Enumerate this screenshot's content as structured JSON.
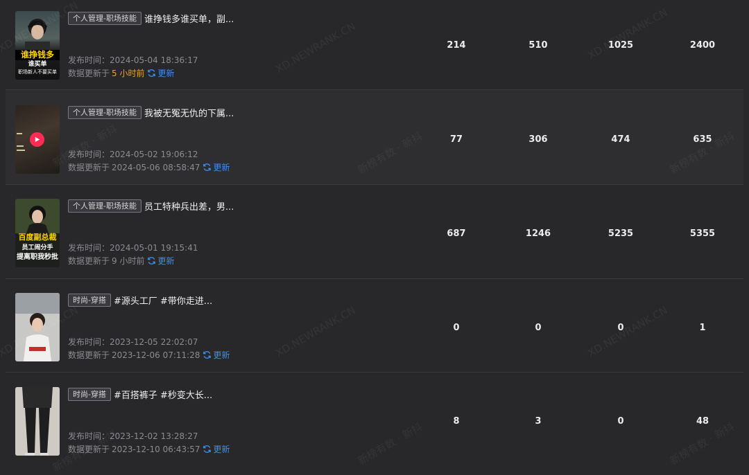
{
  "labels": {
    "published_prefix": "发布时间：",
    "updated_prefix": "数据更新于",
    "refresh": "更新"
  },
  "watermarks": {
    "site": "XD.NEWRANK.CN",
    "brand": "新榜有数 · 新抖"
  },
  "rows": [
    {
      "tag": "个人管理-职场技能",
      "title": "谁挣钱多谁买单，副...",
      "published": "2024-05-04 18:36:17",
      "updated": "5 小时前",
      "updated_highlight": true,
      "thumb_text": [
        "谁挣钱多",
        "谁买单",
        "职场新人不要买单"
      ],
      "stats": [
        "214",
        "510",
        "1025",
        "2400"
      ]
    },
    {
      "tag": "个人管理-职场技能",
      "title": "我被无冤无仇的下属...",
      "published": "2024-05-02 19:06:12",
      "updated": "2024-05-06 08:58:47",
      "updated_highlight": false,
      "thumb_text": [],
      "stats": [
        "77",
        "306",
        "474",
        "635"
      ]
    },
    {
      "tag": "个人管理-职场技能",
      "title": "员工特种兵出差，男...",
      "published": "2024-05-01 19:15:41",
      "updated": "9 小时前",
      "updated_highlight": false,
      "thumb_text": [
        "百度副总裁",
        "员工闹分手",
        "提离职我秒批"
      ],
      "stats": [
        "687",
        "1246",
        "5235",
        "5355"
      ]
    },
    {
      "tag": "时尚-穿搭",
      "title": "#源头工厂 #带你走进...",
      "published": "2023-12-05 22:02:07",
      "updated": "2023-12-06 07:11:28",
      "updated_highlight": false,
      "thumb_text": [],
      "stats": [
        "0",
        "0",
        "0",
        "1"
      ]
    },
    {
      "tag": "时尚-穿搭",
      "title": "#百搭裤子 #秒变大长...",
      "published": "2023-12-02 13:28:27",
      "updated": "2023-12-10 06:43:57",
      "updated_highlight": false,
      "thumb_text": [],
      "stats": [
        "8",
        "3",
        "0",
        "48"
      ]
    }
  ]
}
